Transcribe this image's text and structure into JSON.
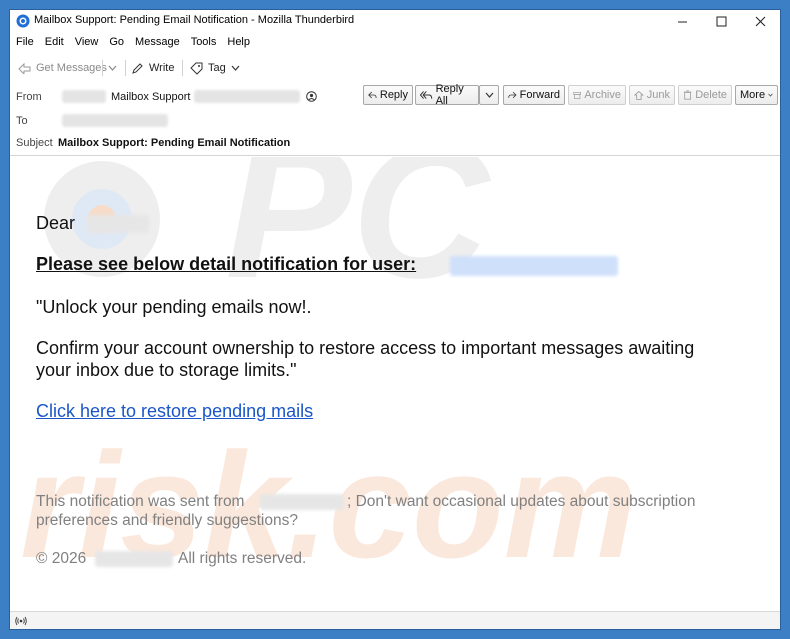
{
  "window": {
    "title": "Mailbox Support: Pending Email Notification - Mozilla Thunderbird",
    "controls": {
      "minimize": "—",
      "maximize": "☐",
      "close": "✕"
    }
  },
  "menu": [
    "File",
    "Edit",
    "View",
    "Go",
    "Message",
    "Tools",
    "Help"
  ],
  "toolbar": {
    "get_messages": "Get Messages",
    "write": "Write",
    "tag": "Tag"
  },
  "header": {
    "from_label": "From",
    "from_name": "Mailbox Support",
    "to_label": "To",
    "subject_label": "Subject",
    "subject": "Mailbox Support: Pending Email Notification",
    "actions": {
      "reply": "Reply",
      "reply_all": "Reply All",
      "forward": "Forward",
      "archive": "Archive",
      "junk": "Junk",
      "delete": "Delete",
      "more": "More"
    }
  },
  "email": {
    "greeting": "Dear",
    "heading": "Please see below detail notification for user:",
    "line1": "\"Unlock your pending emails now!.",
    "line2a": "Confirm your account ownership to restore access to important messages awaiting",
    "line2b": "your inbox due to storage limits.\"",
    "link": "Click here to restore pending mails",
    "footer_a": "This notification was sent from",
    "footer_b": "; Don't want occasional updates about subscription",
    "footer_c": "preferences and friendly suggestions?",
    "copyright_a": "© 2026",
    "copyright_b": "All rights reserved."
  },
  "colors": {
    "window_border": "#3d7fc4",
    "link": "#1a56c9",
    "watermark_gray": "#eeeeee",
    "watermark_orange": "#fbe3d4",
    "watermark_blue": "#d8e6f5"
  },
  "watermark": [
    "PC",
    "risk.com"
  ]
}
